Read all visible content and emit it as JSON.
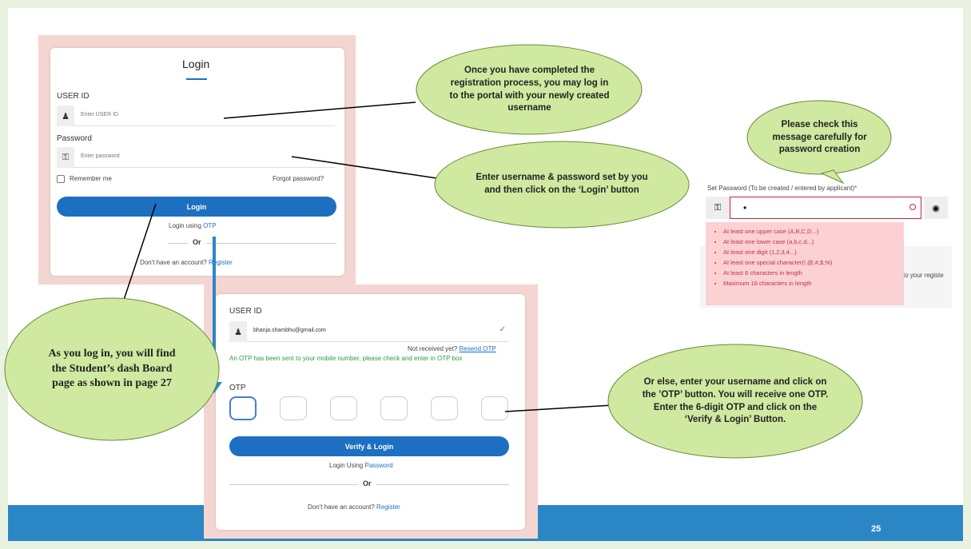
{
  "login_card": {
    "title": "Login",
    "userid_label": "USER ID",
    "userid_placeholder": "Enter USER ID",
    "password_label": "Password",
    "password_placeholder": "Enter password",
    "remember_label": "Remember me",
    "forgot_label": "Forgot password?",
    "login_button": "Login",
    "login_using_text": "Login using",
    "otp_link": "OTP",
    "or_text": "Or",
    "no_account_text": "Don't have an account?",
    "register_link": "Register"
  },
  "otp_card": {
    "userid_label": "USER ID",
    "userid_value": "bhanja.shambhu@gmail.com",
    "not_received_text": "Not received yet?",
    "resend_link": "Resend OTP",
    "otp_sent_msg": "An OTP has been sent to your mobile number, please check and enter in OTP box",
    "otp_label": "OTP",
    "verify_button": "Verify & Login",
    "login_using_text": "Login Using",
    "password_link": "Password",
    "or_text": "Or",
    "no_account_text": "Don't have an account?",
    "register_link": "Register"
  },
  "password_panel": {
    "label": "Set Password (To be created / entered by applicant)",
    "required_mark": "*",
    "value": "•",
    "rules": [
      "At least one upper case (A,B,C,D...)",
      "At least one lower case (a,b,c,d...)",
      "At least one digit (1,2,3,4...)",
      "At least one special character(!,@,#,$,%)",
      "At least 6 characters in length",
      "Maximum 16 characters in length"
    ],
    "cutoff_text": "to your registe"
  },
  "callouts": {
    "registration": "Once you have completed the registration process, you may log in to the portal with your newly created username",
    "enter_credentials": "Enter username & password set by you and then click on the ‘Login’ button",
    "check_message": "Please check this message carefully for password creation",
    "dashboard": "As you log in, you will find the Student’s dash Board page as shown in page 27",
    "otp_instructions": "Or else, enter your username and click on the ’OTP’ button. You will receive one OTP. Enter the 6-digit OTP and click on the ‘Verify & Login’ Button."
  },
  "colors": {
    "accent": "#1d6fc2",
    "callout_fill": "#cfe9a0",
    "footer": "#2b86c6"
  },
  "footer": {
    "page_number": "25"
  }
}
